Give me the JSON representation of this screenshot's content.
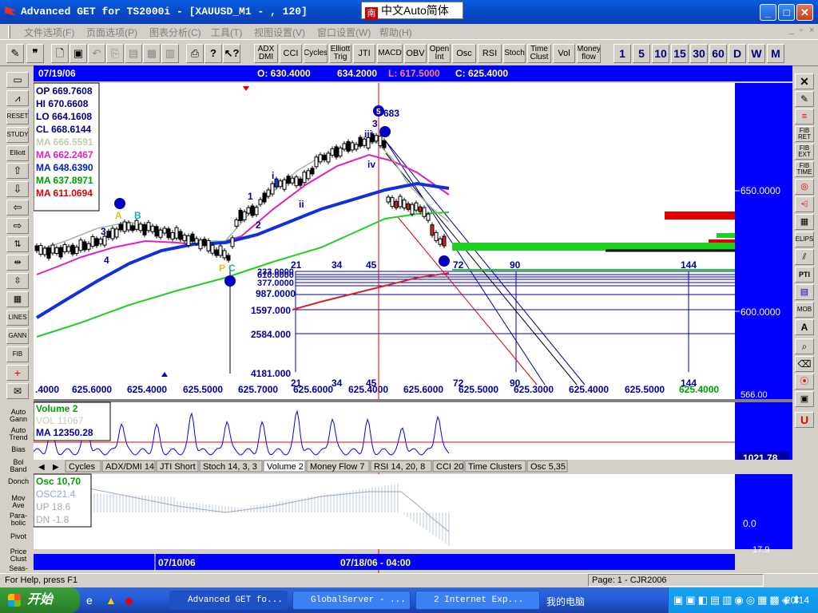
{
  "window": {
    "title": "Advanced GET for TS2000i - [XAUUSD_M1 - , 120]",
    "ime": "中文Auto简体",
    "min": "_",
    "max": "□",
    "close": "✕"
  },
  "menu": [
    "文件选项(F)",
    "页面选项(P)",
    "图表分析(C)",
    "工具(T)",
    "视图设置(V)",
    "窗口设置(W)",
    "帮助(H)"
  ],
  "toolbar": {
    "studies": [
      "ADX DMI",
      "CCI",
      "Cycles",
      "Elliott Trig",
      "JTI",
      "MACD",
      "OBV",
      "Open Int",
      "Osc",
      "RSI",
      "Stoch",
      "Time Clust",
      "Vol",
      "Money flow"
    ],
    "timeframes": [
      "1",
      "5",
      "10",
      "15",
      "30",
      "60",
      "D",
      "W",
      "M"
    ]
  },
  "chart_header": {
    "date": "07/19/06",
    "open": "O: 630.4000",
    "high": "634.2000",
    "low": "L: 617.5000",
    "close": "C: 625.4000"
  },
  "info_box": [
    {
      "label": "OP 669.7608",
      "color": "#000080"
    },
    {
      "label": "HI  670.6608",
      "color": "#000080"
    },
    {
      "label": "LO  664.1608",
      "color": "#000080"
    },
    {
      "label": "CL  668.6144",
      "color": "#000080"
    },
    {
      "label": "MA 666.5591",
      "color": "#c0d0a8"
    },
    {
      "label": "MA 662.2467",
      "color": "#e020c0"
    },
    {
      "label": "MA 648.6390",
      "color": "#0020c0"
    },
    {
      "label": "MA 637.8971",
      "color": "#00a000"
    },
    {
      "label": "MA 611.0694",
      "color": "#e00000"
    }
  ],
  "price_axis": [
    "650.0000",
    "600.0000",
    "566.00"
  ],
  "fib_levels": [
    "987.0000",
    "1597.000",
    "2584.000",
    "4181.000"
  ],
  "fib_top_labels": [
    "610.0000",
    "377.0000",
    "233.0000"
  ],
  "time_counts": [
    "21",
    "34",
    "45",
    "72",
    "90",
    "144"
  ],
  "price_labels_bottom": [
    ".4000",
    "625.6000",
    "625.4000",
    "625.5000",
    "625.7000",
    "625.6000",
    "625.4000",
    "625.6000",
    "625.5000",
    "625.3000",
    "625.4000",
    "625.5000",
    "625.4000"
  ],
  "elliott": {
    "wave_5_label": "5",
    "wave_5_value": "683",
    "labels": [
      "i",
      "ii",
      "iii",
      "iv",
      "1",
      "2",
      "3",
      "4",
      "A",
      "B",
      "C",
      "P",
      "3"
    ]
  },
  "volume_panel": {
    "title": "Volume 2",
    "vol": "VOL 11067",
    "ma": "MA  12350.28",
    "axis_value": "1021.78"
  },
  "tabs": [
    "Cycles",
    "ADX/DMI 14",
    "JTI Short",
    "Stoch 14, 3, 3",
    "Volume 2",
    "Money Flow 7",
    "RSI 14, 20, 8",
    "CCI 20",
    "Time Clusters",
    "Osc 5,35"
  ],
  "osc_panel": {
    "title": "Osc 10,70",
    "osc": "OSC21.4",
    "up": "UP   18.6",
    "dn": "DN  -1.8",
    "axis_zero": "0.0",
    "axis_low": "17.9"
  },
  "date_bar": {
    "left": "07/10/06",
    "center": "07/18/06 - 04:00"
  },
  "left_tools": [
    "Auto Gann",
    "Auto Trend",
    "Bias",
    "Bol Band",
    "Donch",
    "Mov Ave",
    "Para-bolic",
    "Pivot",
    "Price Clust",
    "Seas-"
  ],
  "left_tools_top": [
    "RESET",
    "STUDY",
    "Elliott",
    "LINES",
    "GANN",
    "FIB"
  ],
  "right_tools": [
    "FIB RET",
    "FIB EXT",
    "FIB TIME",
    "ELIPS",
    "PTI",
    "MOB",
    "A"
  ],
  "status": {
    "help": "For Help, press F1",
    "page": "Page: 1 - CJR2006"
  },
  "taskbar": {
    "start": "开始",
    "tasks": [
      "Advanced GET fo...",
      "GlobalServer - ...",
      "2 Internet Exp..."
    ],
    "tray_text": "我的电脑",
    "clock": "20:14"
  },
  "colors": {
    "panel_blue": "#0000ff",
    "chart_bg": "#ffffff",
    "ma_blue": "#1030e0",
    "ma_green": "#20d020",
    "ma_red": "#e02020",
    "ma_magenta": "#e020c0"
  }
}
